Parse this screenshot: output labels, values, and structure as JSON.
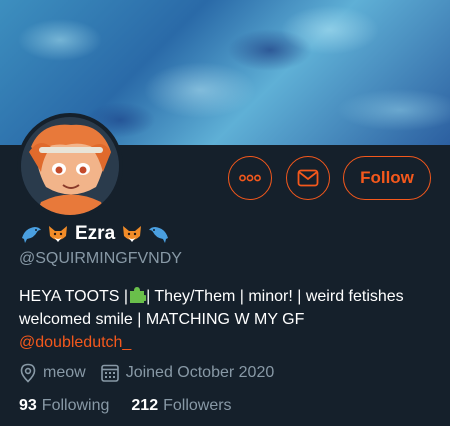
{
  "profile": {
    "display_name": "Ezra",
    "handle": "@SQUIRMINGFVNDY",
    "bio_text": "HEYA TOOTS |",
    "bio_text_2": "| They/Them | minor! | weird fetishes welcomed smile | MATCHING W MY GF",
    "bio_link": "@doubledutch_",
    "location": "meow",
    "joined": "Joined October 2020",
    "following_count": "93",
    "following_label": "Following",
    "followers_count": "212",
    "followers_label": "Followers"
  },
  "actions": {
    "follow_label": "Follow",
    "more_icon": "more-icon",
    "message_icon": "mail-icon"
  },
  "colors": {
    "accent": "#f4581c",
    "background": "#15202b",
    "secondary_text": "#8899a6"
  }
}
